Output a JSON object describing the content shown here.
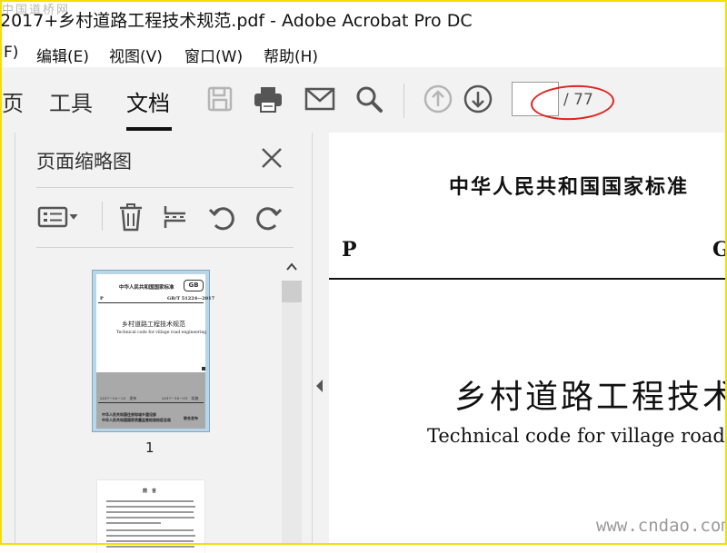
{
  "window": {
    "title": "2017+乡村道路工程技术规范.pdf - Adobe Acrobat Pro DC",
    "watermark_top": "中国道桥网",
    "watermark_bottom": "www.cndao.com"
  },
  "menubar": {
    "items": [
      "F)",
      "编辑(E)",
      "视图(V)",
      "窗口(W)",
      "帮助(H)"
    ]
  },
  "toolbar": {
    "tabs": [
      "页",
      "工具",
      "文档"
    ],
    "active_tab": "文档",
    "icons": [
      "save-icon",
      "print-icon",
      "email-icon",
      "search-icon",
      "previous-page-icon",
      "next-page-icon"
    ],
    "page_input_value": "",
    "page_total": "/ 77",
    "annotation_color": "#e0241e"
  },
  "sidebar": {
    "title": "页面缩略图",
    "icons": [
      "thumbnail-options-icon",
      "delete-page-icon",
      "extract-page-icon",
      "rotate-left-icon",
      "rotate-right-icon"
    ],
    "thumbnails": [
      {
        "label": "1",
        "header": "中华人民共和国国家标准",
        "code_left": "P",
        "code_right": "GB/T 51224—2017",
        "title": "乡村道路工程技术规范",
        "subtitle": "Technical code for village road engineering",
        "date_left": "2017－02－21　发布",
        "date_right": "2017－10－01　实施",
        "publisher": "中华人民共和国住房和城乡建设部\n中华人民共和国国家质量监督检验检疫总局",
        "publisher_suffix": "联合发布",
        "logo": "GB"
      },
      {
        "label": "",
        "heading": "前　言"
      }
    ]
  },
  "document": {
    "header": "中华人民共和国国家标准",
    "code_left": "P",
    "code_right": "G",
    "title": "乡村道路工程技术",
    "subtitle": "Technical code for village road e"
  }
}
